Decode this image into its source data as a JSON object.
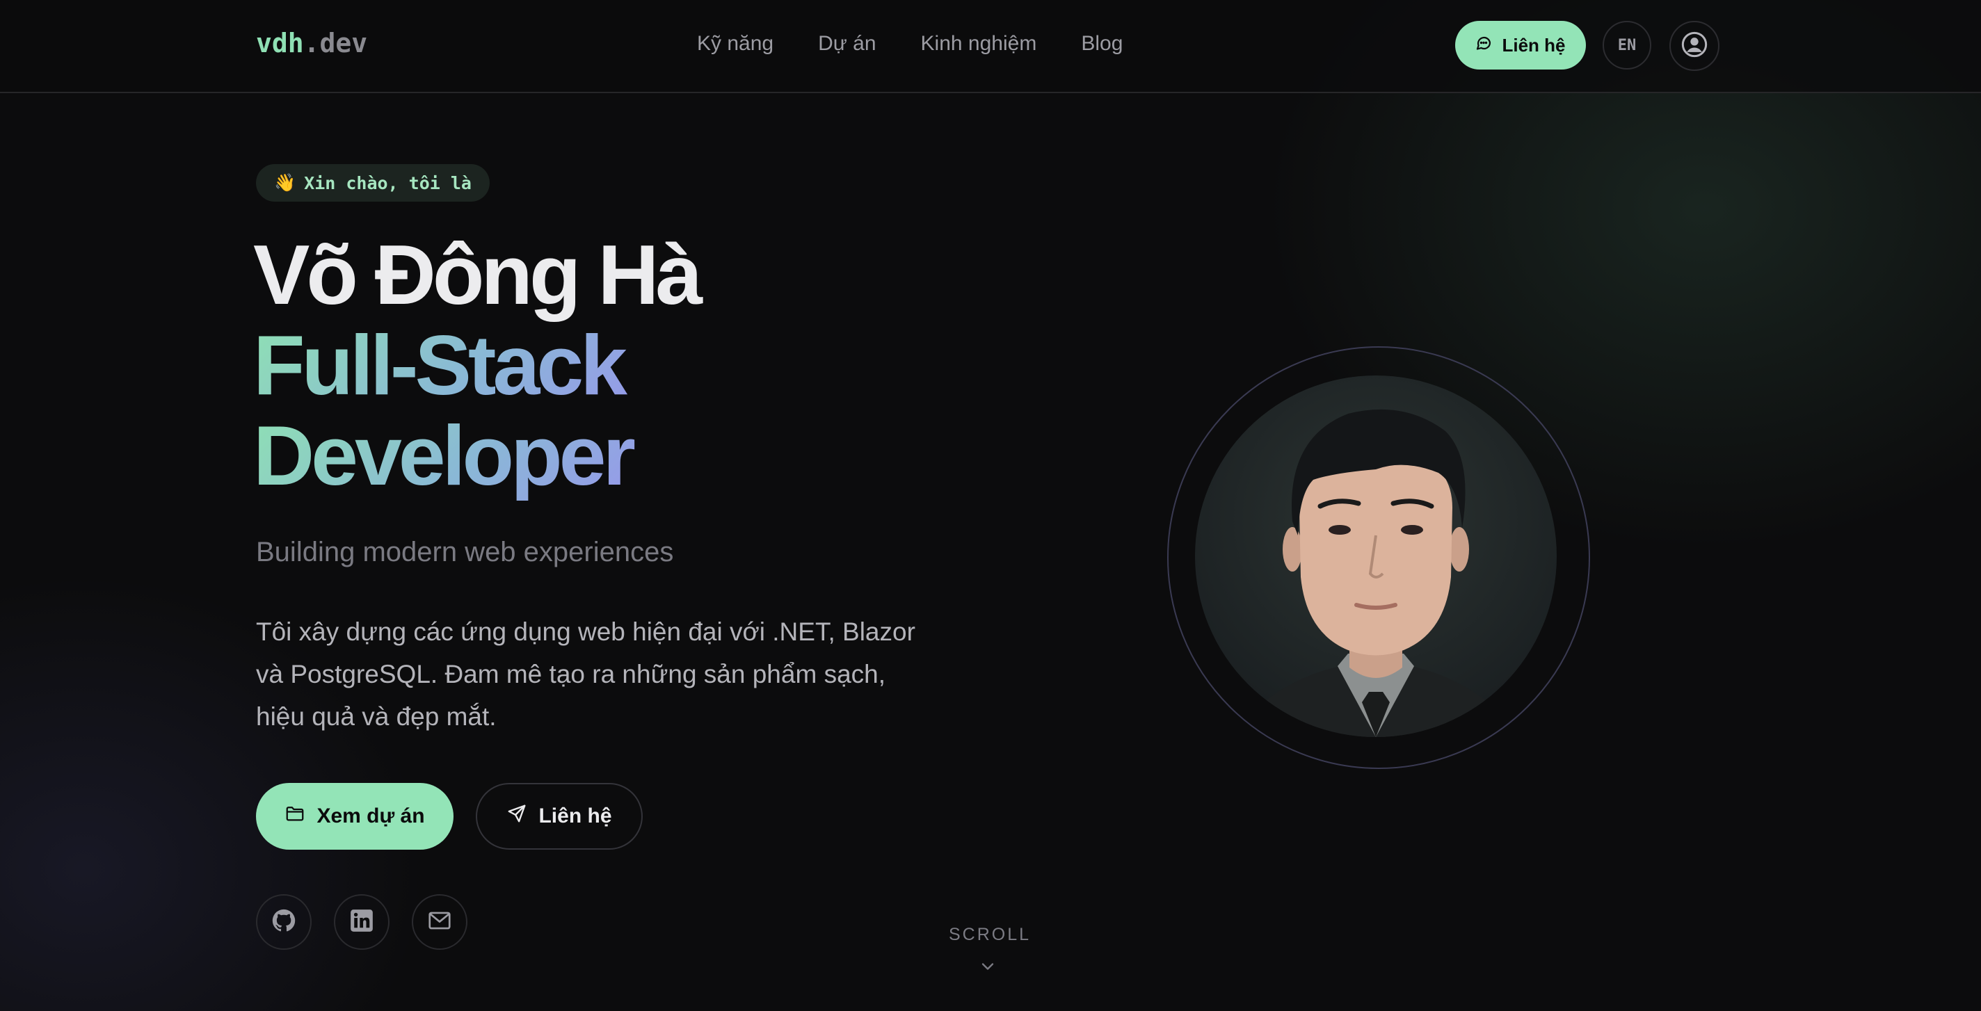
{
  "nav": {
    "logo_main": "vdh",
    "logo_dot": ".",
    "logo_tld": "dev",
    "items": [
      {
        "label": "Kỹ năng"
      },
      {
        "label": "Dự án"
      },
      {
        "label": "Kinh nghiệm"
      },
      {
        "label": "Blog"
      }
    ],
    "contact_label": "Liên hệ",
    "contact_icon": "chat-bubble-icon",
    "lang_label": "EN",
    "user_icon": "user-circle-icon"
  },
  "hero": {
    "greeting_emoji": "👋",
    "greeting": "Xin chào, tôi là",
    "name": "Võ Đông Hà",
    "role_line1": "Full-Stack",
    "role_line2": "Developer",
    "subtitle": "Building modern web experiences",
    "description": "Tôi xây dựng các ứng dụng web hiện đại với .NET, Blazor và PostgreSQL. Đam mê tạo ra những sản phẩm sạch, hiệu quả và đẹp mắt.",
    "primary_button": "Xem dự án",
    "primary_icon": "folder-icon",
    "secondary_button": "Liên hệ",
    "secondary_icon": "send-icon",
    "socials": [
      {
        "icon": "github-icon"
      },
      {
        "icon": "linkedin-icon"
      },
      {
        "icon": "mail-icon"
      }
    ],
    "scroll_label": "SCROLL"
  },
  "colors": {
    "accent": "#93e4b7",
    "gradient_start": "#8fe0b4",
    "gradient_end": "#9a8ff0",
    "background": "#0c0c0d"
  }
}
